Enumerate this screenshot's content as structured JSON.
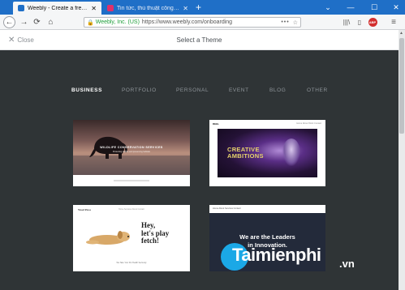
{
  "browser": {
    "tabs": [
      {
        "label": "Weebly - Create a free website",
        "active": true,
        "favicon": "weebly-heart-icon"
      },
      {
        "label": "Tin tức, thủ thuật công nghệ m",
        "active": false,
        "favicon": "t-logo-icon"
      }
    ],
    "new_tab": "+",
    "window_controls": {
      "tab_list": "⌄",
      "minimize": "—",
      "maximize": "☐",
      "close": "✕"
    },
    "nav": {
      "back": "←",
      "forward": "→",
      "reload": "⟳",
      "home": "⌂"
    },
    "url": {
      "site_identity": "Weebly, Inc. (US)",
      "address": "https://www.weebly.com/onboarding",
      "more": "•••",
      "star": "☆"
    },
    "toolbar_icons": {
      "library": "|||\\",
      "sidebar": "▯",
      "addon": "ABP",
      "menu": "≡"
    }
  },
  "page": {
    "close_label": "Close",
    "close_icon": "✕",
    "title": "Select a Theme"
  },
  "categories": [
    "BUSINESS",
    "PORTFOLIO",
    "PERSONAL",
    "EVENT",
    "BLOG",
    "OTHER"
  ],
  "active_category": "BUSINESS",
  "themes": [
    {
      "title": "WILDLIFE CONSERVATION SERVICES",
      "sub": "Protecting wildlife and preserving habitats"
    },
    {
      "brand": "REEL",
      "title_line1": "CREATIVE",
      "title_line2": "AMBITIONS",
      "links": "Home   About   Work   Contact"
    },
    {
      "brand": "Woof Paws",
      "title_line1": "Hey,",
      "title_line2": "let's play",
      "title_line3": "fetch!",
      "links": "Home   Services   About   Contact",
      "footer": "We Take Your Pet Health Seriously"
    },
    {
      "nav": "Home   About   Services   Contact",
      "title_line1": "We are the Leaders",
      "title_line2": "in Innovation."
    }
  ],
  "watermark": {
    "text": "aimienphi",
    "suffix": ".vn"
  },
  "colors": {
    "tabbar": "#1f6fc7",
    "content_bg": "#2f3436",
    "accent_green": "#1e9e3a",
    "active_category": "#ffffff",
    "inactive_category": "#8e9499"
  }
}
